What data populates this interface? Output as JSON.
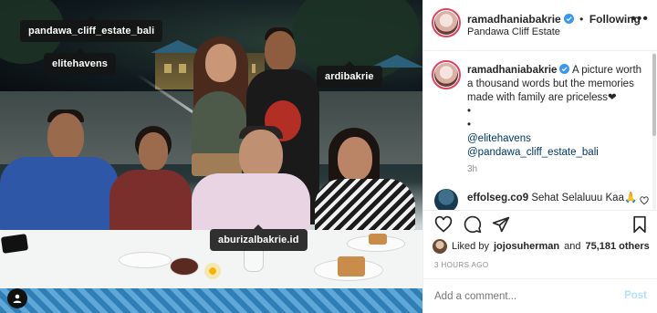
{
  "photo": {
    "tags": {
      "estate": "pandawa_cliff_estate_bali",
      "elitehavens": "elitehavens",
      "ardibakrie": "ardibakrie",
      "aburizal": "aburizalbakrie.id"
    },
    "user_tag_icon": "person-icon"
  },
  "header": {
    "username": "ramadhaniabakrie",
    "separator": "•",
    "follow_status": "Following",
    "location": "Pandawa Cliff Estate",
    "more_icon": "ellipsis-icon"
  },
  "caption": {
    "username": "ramadhaniabakrie",
    "text": "A picture worth a thousand words but the memories made with family are priceless❤",
    "bullet1": "•",
    "bullet2": "•",
    "mention1": "@elitehavens",
    "mention2": "@pandawa_cliff_estate_bali",
    "time_ago": "3h"
  },
  "comment": {
    "username": "effolseg.co9",
    "text": "Sehat Selaluuu Kaa🙏"
  },
  "actions": {
    "like_icon": "heart-icon",
    "comment_icon": "comment-icon",
    "share_icon": "send-icon",
    "save_icon": "bookmark-icon"
  },
  "likes": {
    "prefix": "Liked by",
    "user": "jojosuherman",
    "middle": "and",
    "count": "75,181 others"
  },
  "post_date": "3 HOURS AGO",
  "comment_box": {
    "placeholder": "Add a comment...",
    "post_label": "Post"
  },
  "colors": {
    "verified_blue": "#3897f0",
    "mention_blue": "#00376b",
    "post_disabled": "#b2dffc",
    "story_ring": "#e4405f"
  }
}
